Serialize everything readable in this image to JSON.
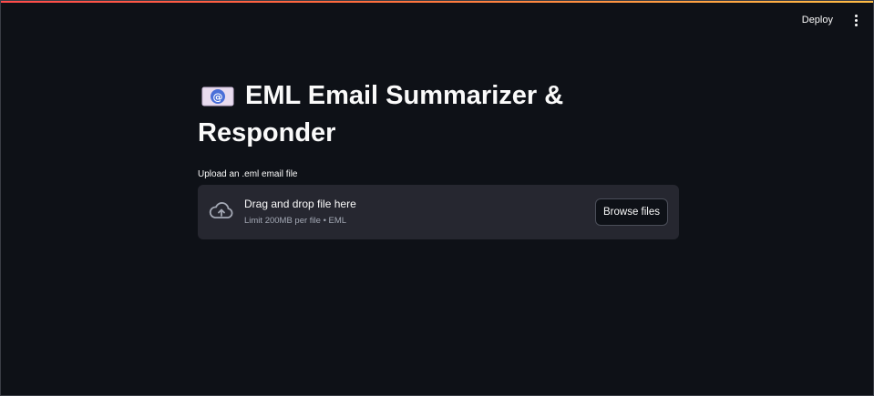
{
  "header": {
    "deploy_label": "Deploy",
    "menu_icon": "more-vertical-icon"
  },
  "page": {
    "title_icon": "email-at-icon",
    "title": "EML Email Summarizer & Responder"
  },
  "uploader": {
    "label": "Upload an .eml email file",
    "icon": "cloud-upload-icon",
    "drop_text": "Drag and drop file here",
    "limit_text": "Limit 200MB per file • EML",
    "browse_label": "Browse files"
  },
  "colors": {
    "background": "#0e1117",
    "dropzone": "#262730",
    "text": "#fafafa",
    "muted": "#a3a8b4",
    "accent_start": "#ff4b4b",
    "accent_end": "#ffbd45"
  }
}
